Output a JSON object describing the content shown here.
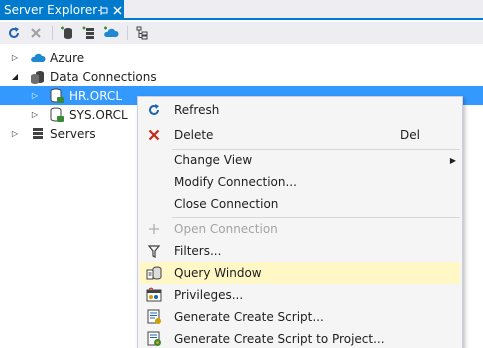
{
  "window": {
    "tab_title": "Server Explorer",
    "pin_glyph": "⊣",
    "close_glyph": "✕"
  },
  "toolbar": {
    "buttons": [
      "refresh-icon",
      "stop-icon",
      "connect-to-database-icon",
      "connect-to-server-icon",
      "connect-to-azure-icon",
      "properties-icon"
    ]
  },
  "tree": {
    "azure": "Azure",
    "data_connections": "Data Connections",
    "hr_orcl": "HR.ORCL",
    "sys_orcl": "SYS.ORCL",
    "servers": "Servers"
  },
  "menu": {
    "refresh": "Refresh",
    "delete": "Delete",
    "delete_shortcut": "Del",
    "change_view": "Change View",
    "modify_connection": "Modify Connection...",
    "close_connection": "Close Connection",
    "open_connection": "Open Connection",
    "filters": "Filters...",
    "query_window": "Query Window",
    "privileges": "Privileges...",
    "generate_create_script": "Generate Create Script...",
    "generate_create_script_project": "Generate Create Script to Project..."
  },
  "colors": {
    "accent": "#007acc",
    "selection": "#3399ff",
    "menu_highlight": "#fff8c6",
    "delete_red": "#c42b1c"
  }
}
